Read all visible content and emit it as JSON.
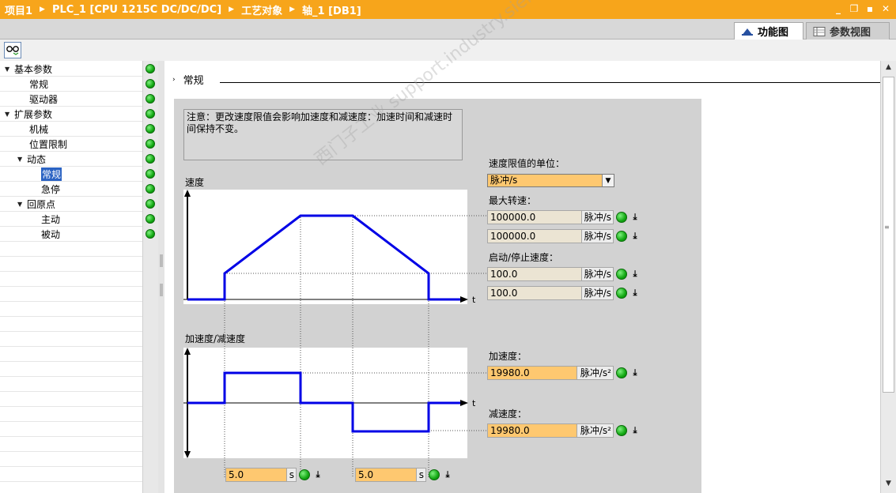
{
  "breadcrumb": [
    "项目1",
    "PLC_1 [CPU 1215C DC/DC/DC]",
    "工艺对象",
    "轴_1 [DB1]"
  ],
  "window_buttons": [
    "_",
    "❐",
    "▪",
    "✕"
  ],
  "view_tabs": [
    {
      "label": "功能图",
      "active": true,
      "icon": "function-view-icon"
    },
    {
      "label": "参数视图",
      "active": false,
      "icon": "parameter-view-icon"
    }
  ],
  "nav": [
    {
      "label": "基本参数",
      "level": 0,
      "expanded": true
    },
    {
      "label": "常规",
      "level": 1
    },
    {
      "label": "驱动器",
      "level": 1
    },
    {
      "label": "扩展参数",
      "level": 0,
      "expanded": true
    },
    {
      "label": "机械",
      "level": 1
    },
    {
      "label": "位置限制",
      "level": 1
    },
    {
      "label": "动态",
      "level": 1,
      "expanded": true
    },
    {
      "label": "常规",
      "level": 2,
      "selected": true
    },
    {
      "label": "急停",
      "level": 2
    },
    {
      "label": "回原点",
      "level": 1,
      "expanded": true
    },
    {
      "label": "主动",
      "level": 2
    },
    {
      "label": "被动",
      "level": 2
    }
  ],
  "section": {
    "title": "常规"
  },
  "note": "注意：更改速度限值会影响加速度和减速度：加速时间和减速时间保持不变。",
  "speed_chart": {
    "title": "速度",
    "axis_t": "t"
  },
  "accel_chart": {
    "title": "加速度/减速度",
    "axis_t": "t"
  },
  "speed_unit": {
    "label": "速度限值的单位：",
    "value": "脉冲/s"
  },
  "max_speed": {
    "label": "最大转速：",
    "value1": "100000.0",
    "unit1": "脉冲/s",
    "value2": "100000.0",
    "unit2": "脉冲/s"
  },
  "start_stop_speed": {
    "label": "启动/停止速度：",
    "value1": "100.0",
    "unit1": "脉冲/s",
    "value2": "100.0",
    "unit2": "脉冲/s"
  },
  "acceleration": {
    "label": "加速度：",
    "value": "19980.0",
    "unit": "脉冲/s²"
  },
  "deceleration": {
    "label": "减速度：",
    "value": "19980.0",
    "unit": "脉冲/s²"
  },
  "accel_time": {
    "value": "5.0",
    "unit": "s"
  },
  "decel_time": {
    "value": "5.0",
    "unit": "s"
  },
  "watermark": "西门子工业 support.industry.siemens.com/cs",
  "colors": {
    "title_bar": "#f7a51b",
    "curve": "#0000e6",
    "input_orange": "#fec870",
    "input_beige": "#ebe4d3",
    "status_ok": "#13a813"
  }
}
